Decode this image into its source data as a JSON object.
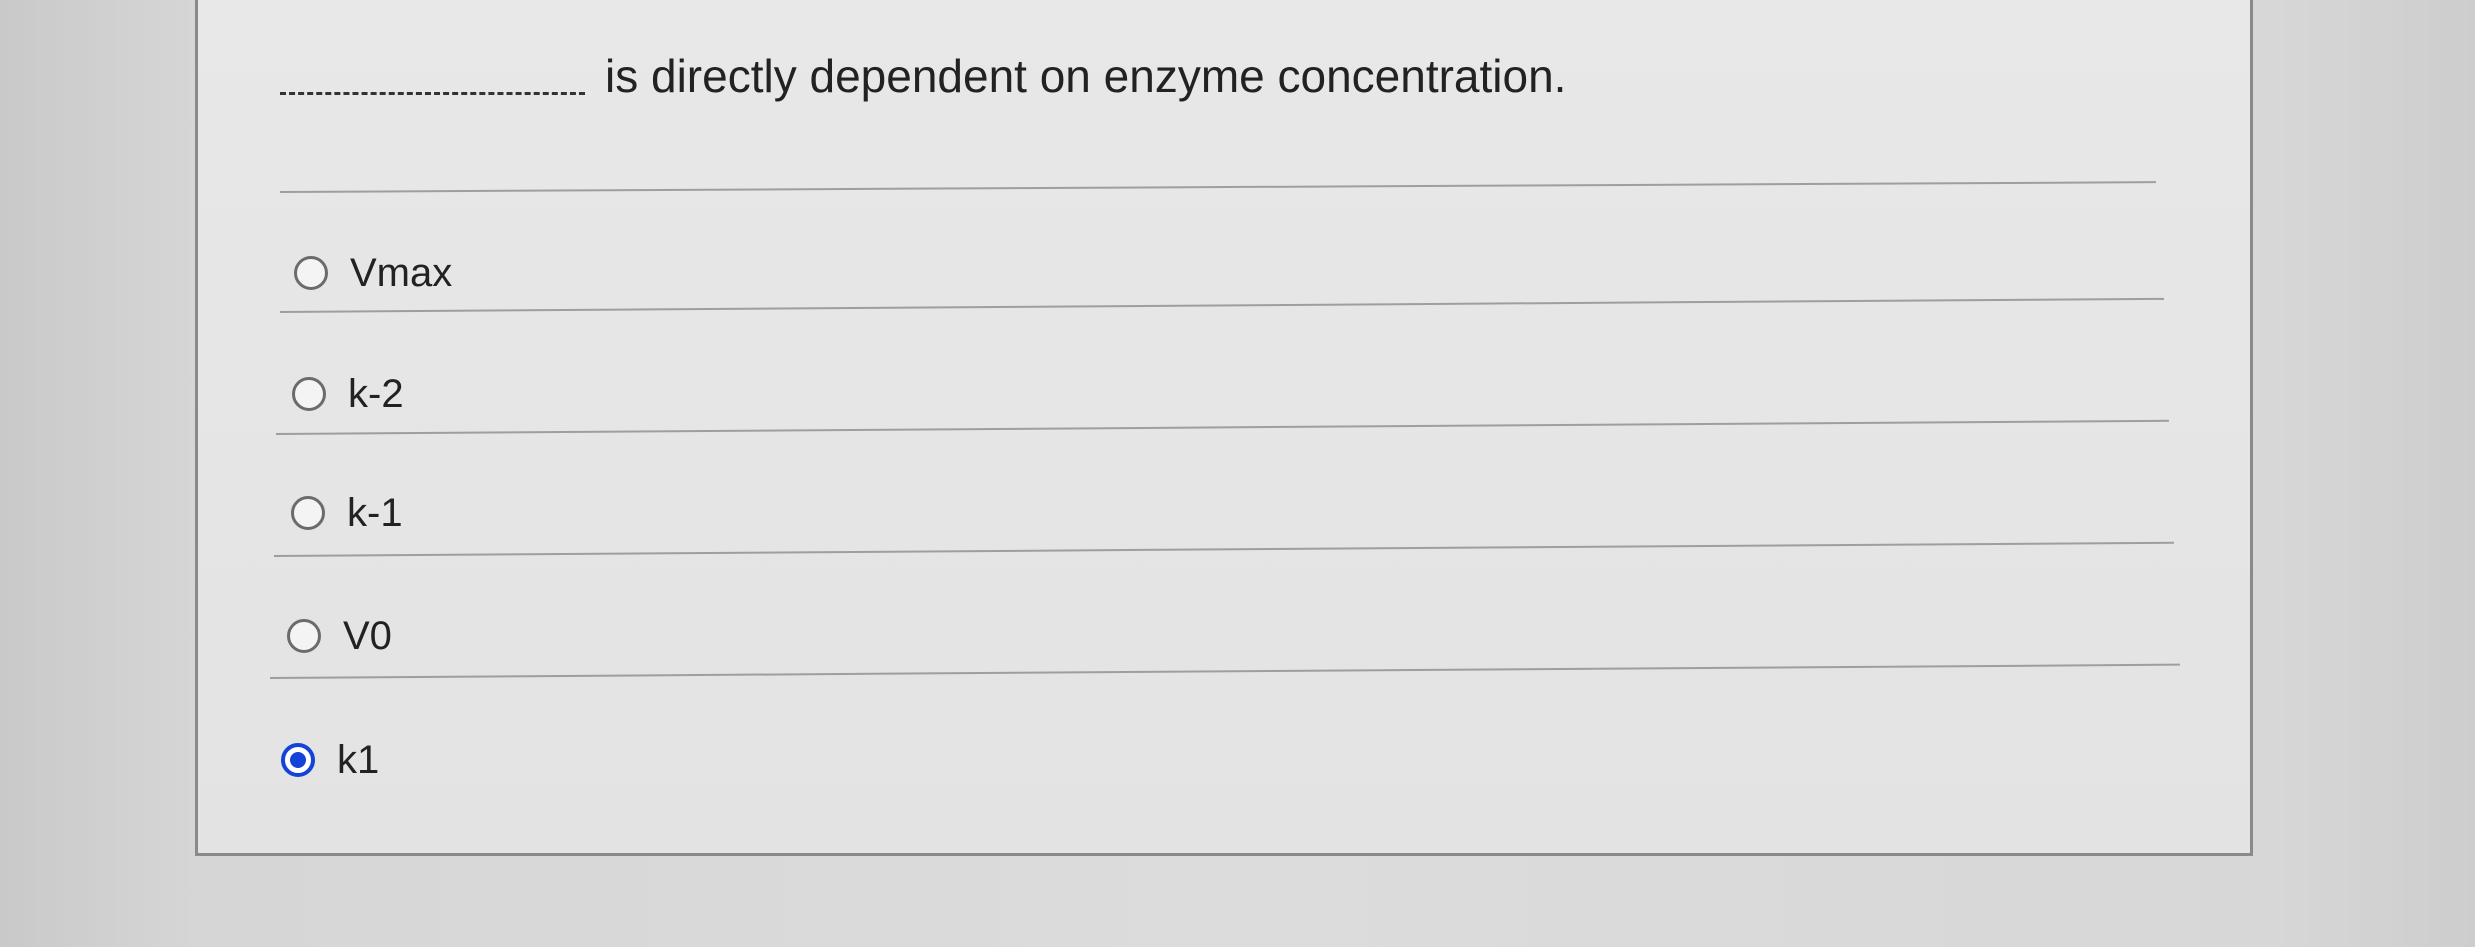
{
  "question": {
    "blank": "",
    "stem": "is directly dependent on enzyme concentration."
  },
  "options": [
    {
      "label": "Vmax",
      "selected": false
    },
    {
      "label": "k-2",
      "selected": false
    },
    {
      "label": "k-1",
      "selected": false
    },
    {
      "label": "V0",
      "selected": false
    },
    {
      "label": "k1",
      "selected": true
    }
  ],
  "colors": {
    "selected_radio": "#1443d9",
    "border": "#8a8a8a"
  }
}
